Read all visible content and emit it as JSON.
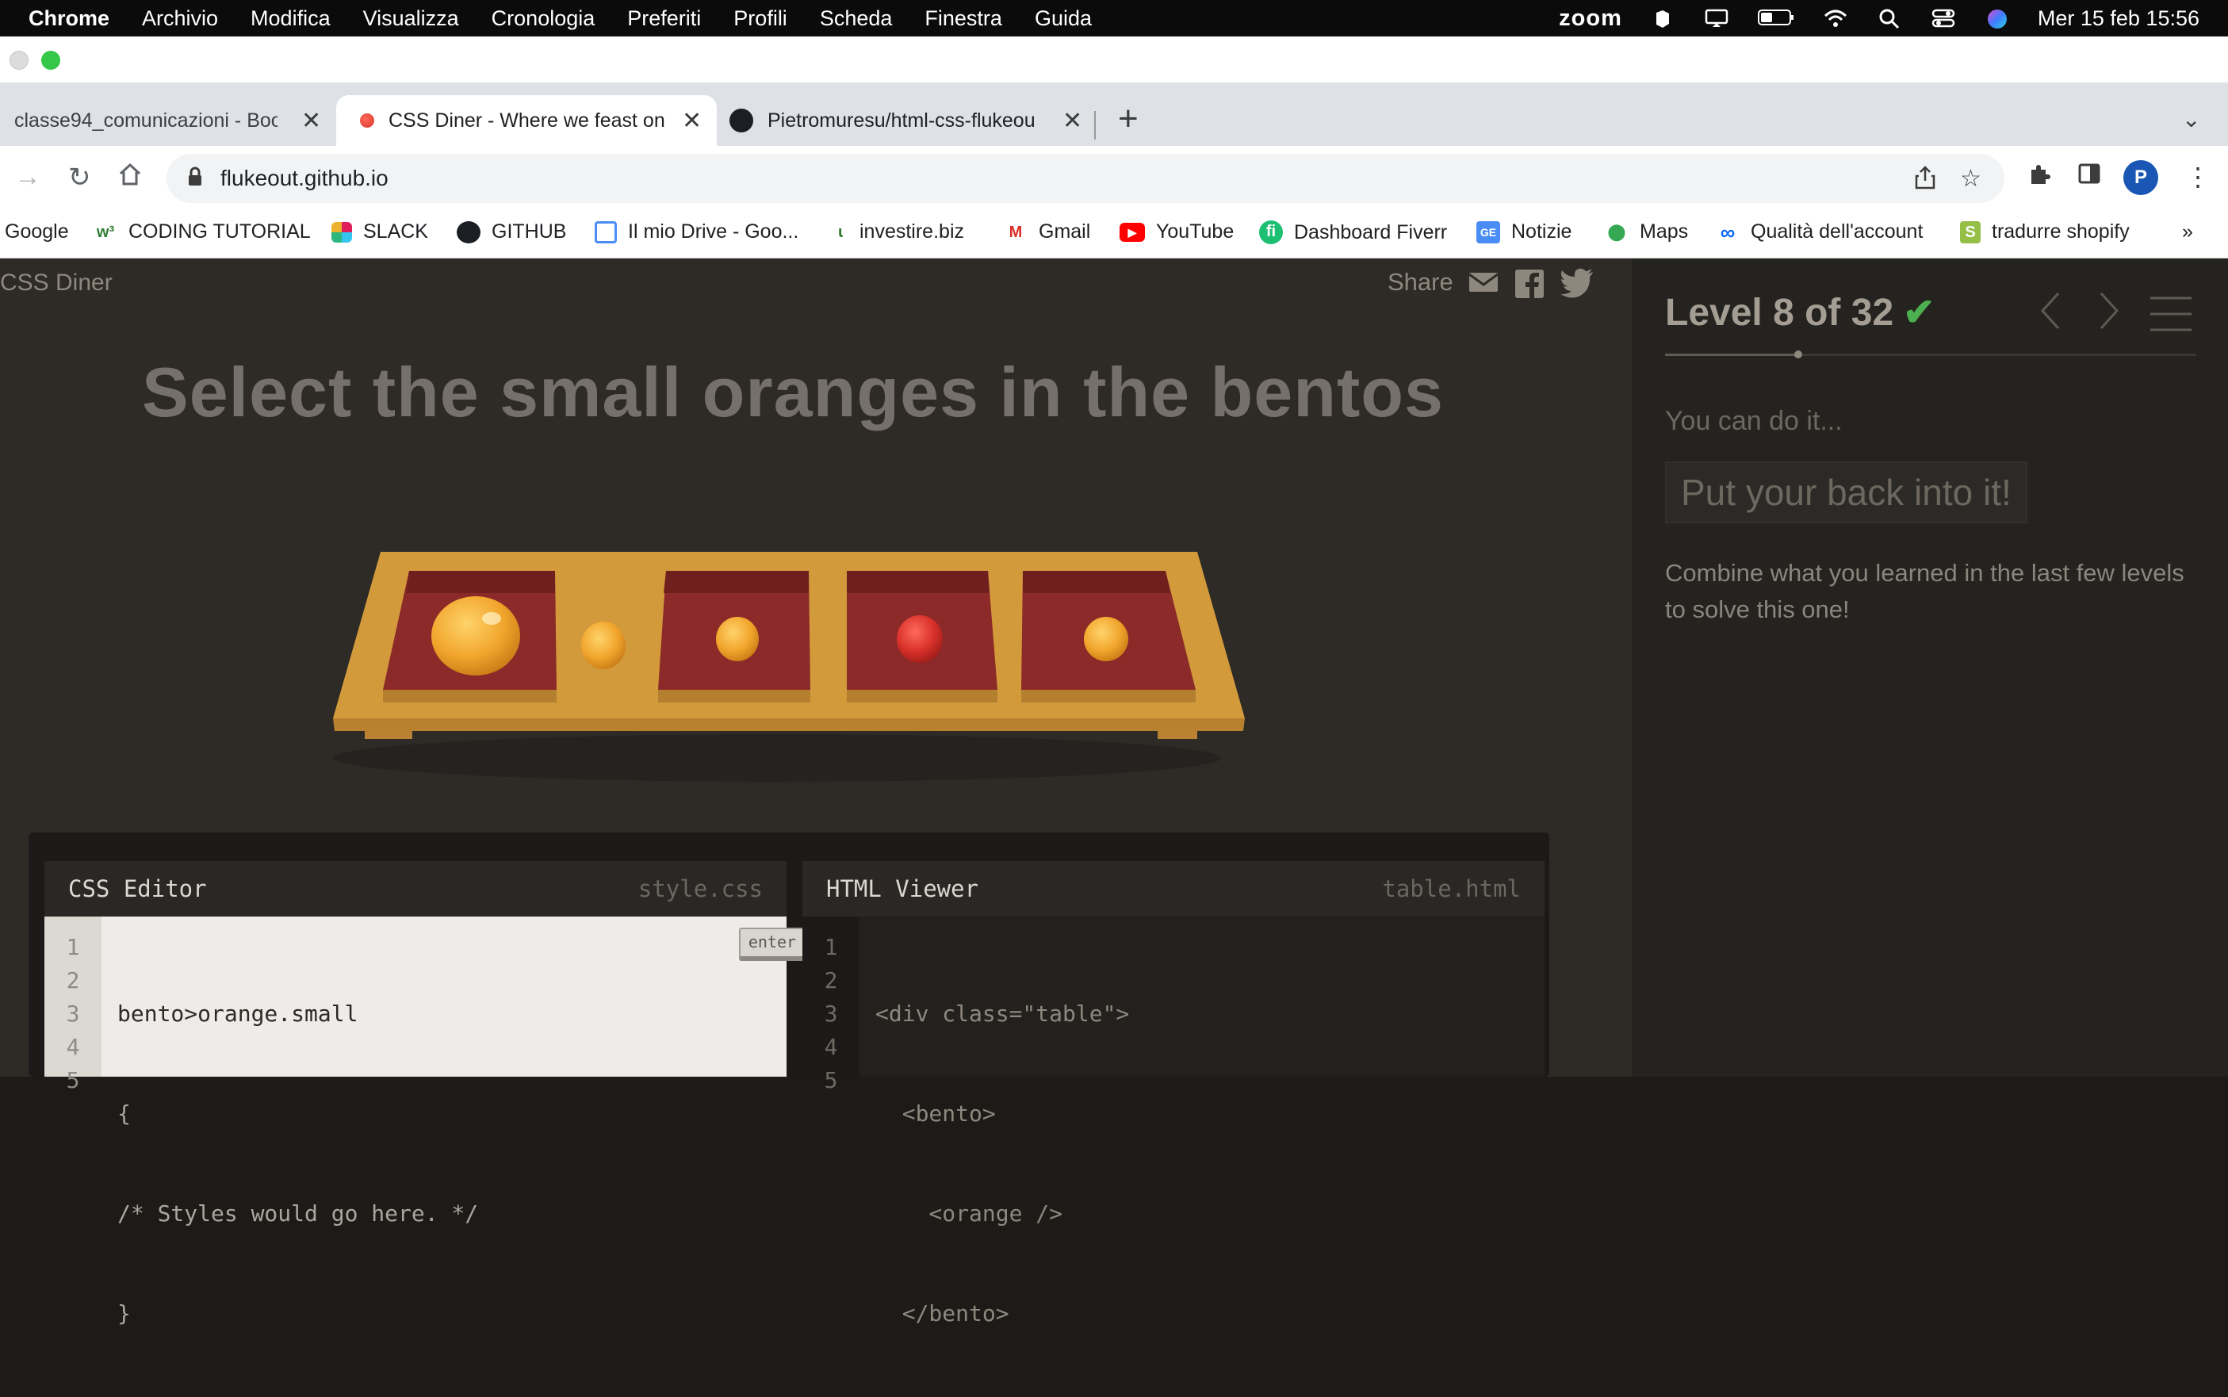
{
  "menubar": {
    "app": "Chrome",
    "items": [
      "Archivio",
      "Modifica",
      "Visualizza",
      "Cronologia",
      "Preferiti",
      "Profili",
      "Scheda",
      "Finestra",
      "Guida"
    ],
    "zoom": "zoom",
    "datetime": "Mer 15 feb  15:56"
  },
  "tabs": [
    {
      "title": "classe94_comunicazioni - Boo"
    },
    {
      "title": "CSS Diner - Where we feast on"
    },
    {
      "title": "Pietromuresu/html-css-flukeou"
    }
  ],
  "address": {
    "url": "flukeout.github.io",
    "avatar": "P"
  },
  "bookmarks": [
    "Google",
    "CODING TUTORIAL",
    "SLACK",
    "GITHUB",
    "Il mio Drive - Goo...",
    "investire.biz",
    "Gmail",
    "YouTube",
    "Dashboard Fiverr",
    "Notizie",
    "Maps",
    "Qualità dell'account",
    "tradurre shopify"
  ],
  "page": {
    "brand": "CSS Diner",
    "share": "Share",
    "order": "Select the small oranges in the bentos"
  },
  "editor": {
    "css_title": "CSS Editor",
    "css_file": "style.css",
    "enter": "enter",
    "css_lines": [
      "bento>orange.small",
      "{",
      "/* Styles would go here. */",
      "}"
    ],
    "html_title": "HTML Viewer",
    "html_file": "table.html",
    "html_lines": [
      "<div class=\"table\">",
      "  <bento>",
      "    <orange />",
      "  </bento>"
    ],
    "line_numbers": [
      "1",
      "2",
      "3",
      "4",
      "5"
    ]
  },
  "sidebar": {
    "level": "Level 8 of 32",
    "check": "✔",
    "progress": 0.25,
    "encourage": "You can do it...",
    "tip": "Put your back into it!",
    "hint": "Combine what you learned in the last few levels to solve this one!"
  },
  "colors": {
    "page_bg": "#2e2b27",
    "sidebar_bg": "#25231f",
    "table_wood": "#d39a3c",
    "bento_red": "#8b2a28",
    "orange": "#f0a92e",
    "apple": "#d8302a",
    "check_green": "#4caf50"
  }
}
